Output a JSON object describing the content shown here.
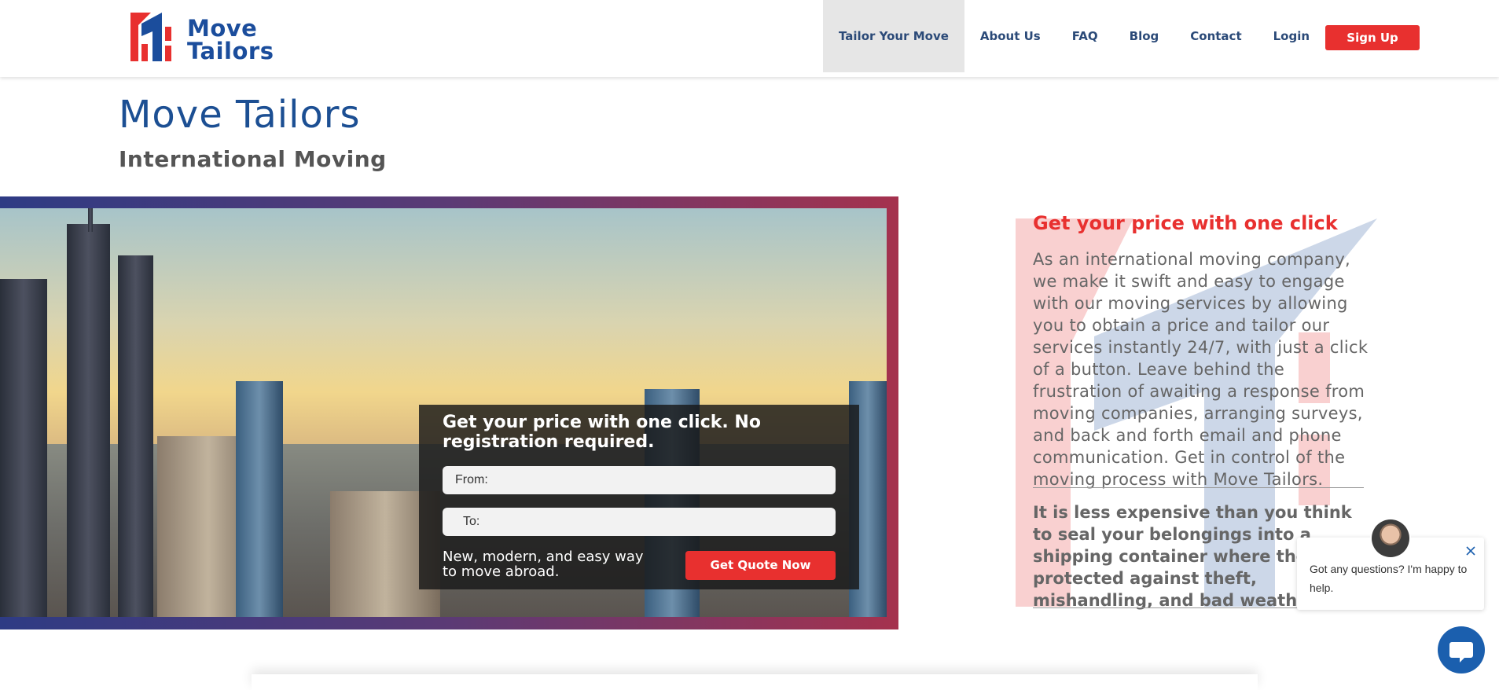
{
  "header": {
    "logo_text_line1": "Move",
    "logo_text_line2": "Tailors",
    "nav": [
      {
        "label": "Tailor Your Move"
      },
      {
        "label": "About Us"
      },
      {
        "label": "FAQ"
      },
      {
        "label": "Blog"
      },
      {
        "label": "Contact"
      },
      {
        "label": "Login"
      }
    ],
    "signup_label": "Sign Up"
  },
  "page": {
    "title": "Move Tailors",
    "subtitle": "International Moving"
  },
  "quote": {
    "heading": "Get your price with one click. No registration required.",
    "from_placeholder": "From:",
    "to_placeholder": "To:",
    "tagline": "New, modern, and easy way to move abroad.",
    "button_label": "Get Quote Now"
  },
  "side": {
    "heading": "Get your price with one click",
    "paragraph": "As an international moving company, we make it swift and easy to engage with our moving services by allowing you to obtain a price and tailor our services instantly 24/7, with just a click of a button. Leave behind the frustration of awaiting a response from moving companies, arranging surveys, and back and forth email and phone communication. Get in control of the moving process with Move Tailors.",
    "bold_text": "It is less expensive than you think to seal your belongings into a shipping container where they are protected against theft, mishandling, and bad weather."
  },
  "chat": {
    "message": "Got any questions? I'm happy to help."
  },
  "colors": {
    "brand_blue": "#1b4d9c",
    "brand_red": "#e8302f"
  },
  "icons": [
    "logo-icon",
    "close-icon",
    "chat-icon",
    "avatar"
  ]
}
